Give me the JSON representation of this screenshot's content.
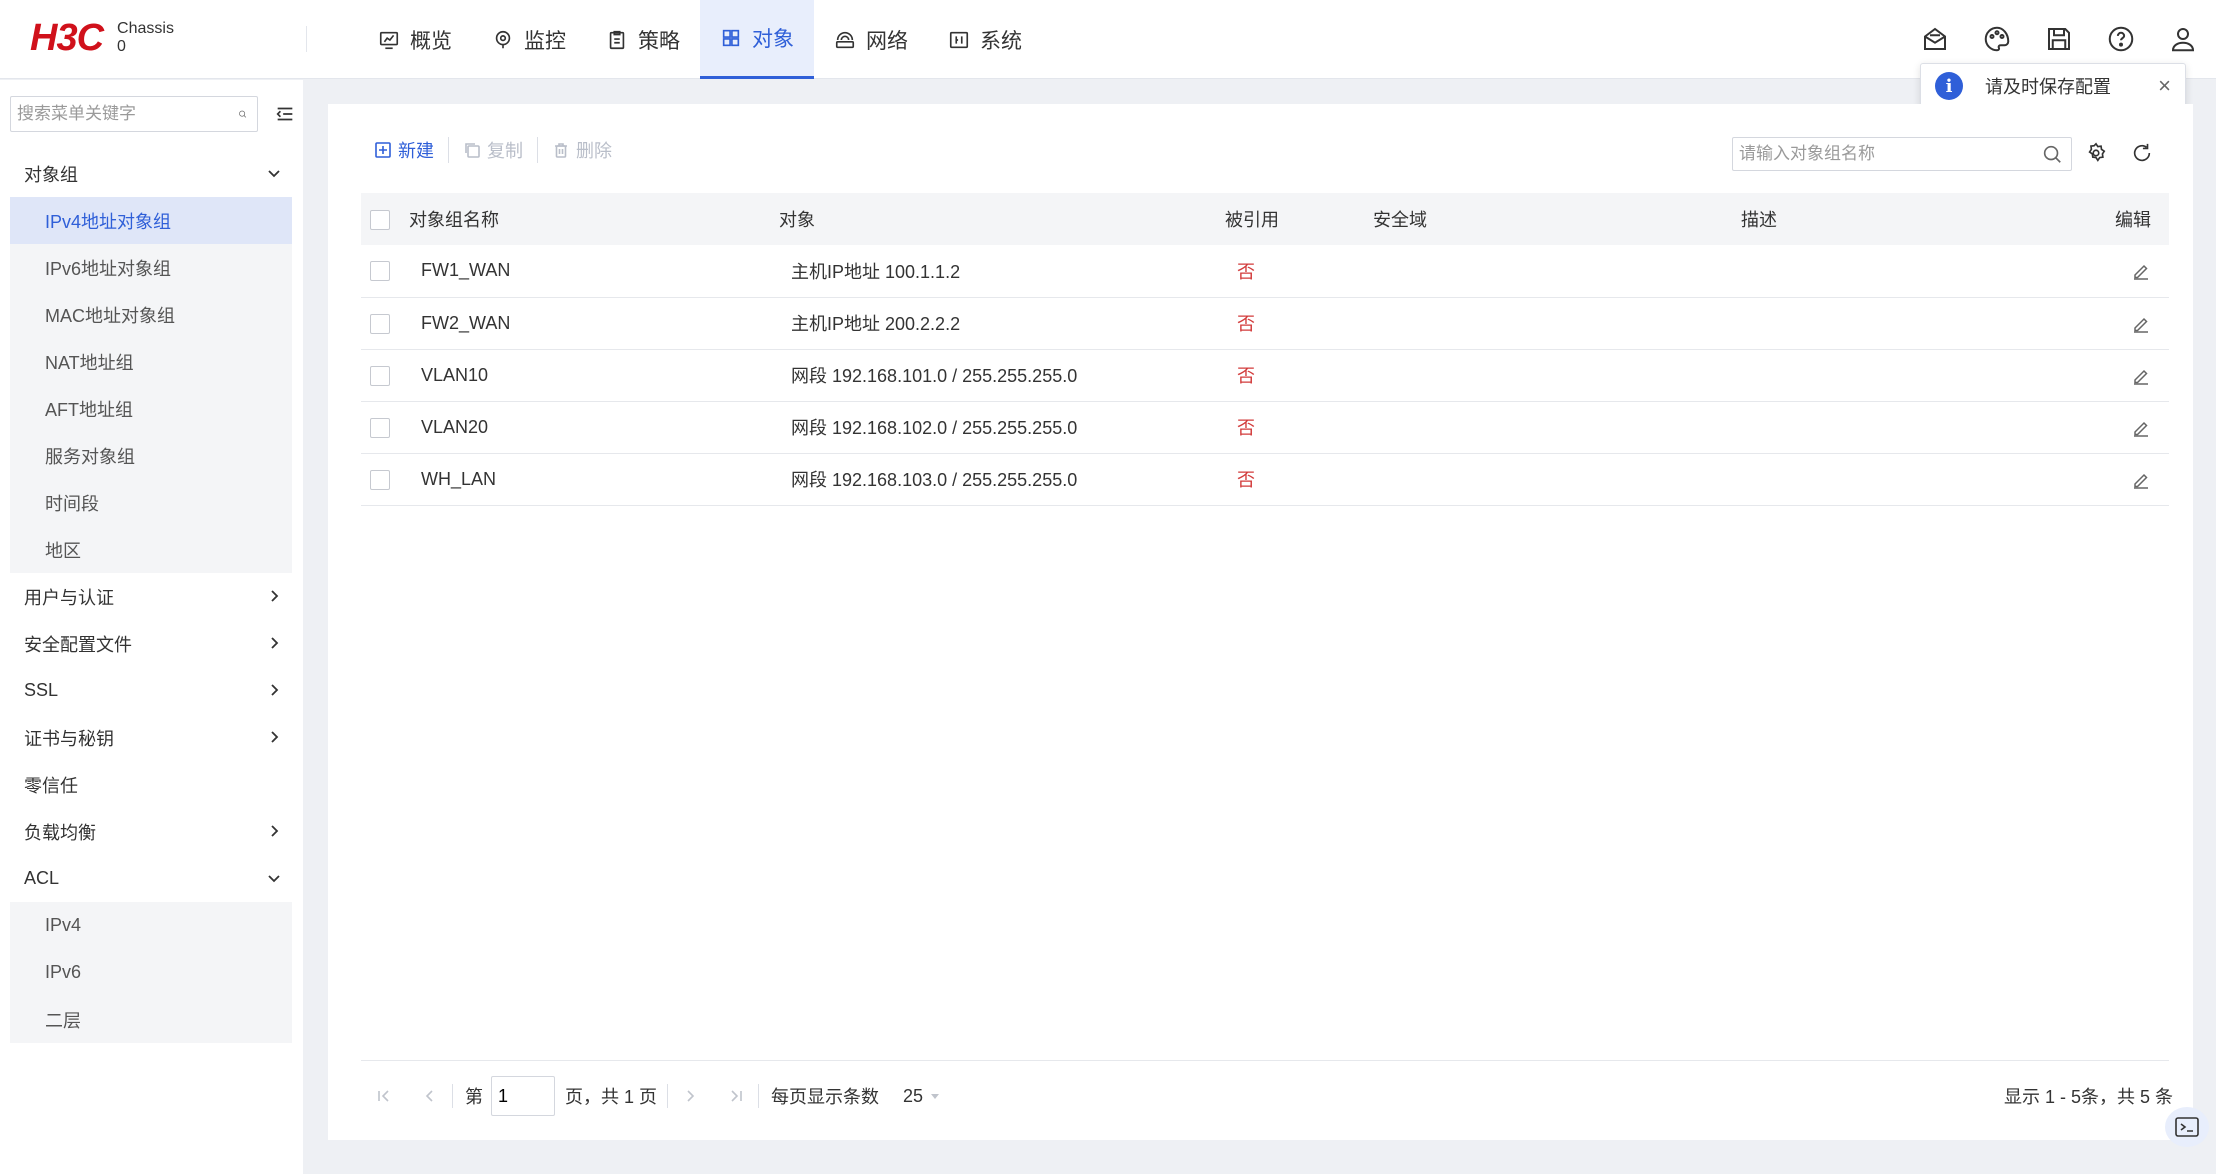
{
  "header": {
    "logo": "H3C",
    "device_line1": "Chassis",
    "device_line2": "0",
    "nav": [
      {
        "label": "概览",
        "icon": "overview-icon"
      },
      {
        "label": "监控",
        "icon": "monitor-icon"
      },
      {
        "label": "策略",
        "icon": "policy-icon"
      },
      {
        "label": "对象",
        "icon": "object-icon",
        "active": true
      },
      {
        "label": "网络",
        "icon": "network-icon"
      },
      {
        "label": "系统",
        "icon": "system-icon"
      }
    ],
    "tools": [
      "message-icon",
      "theme-icon",
      "save-icon",
      "help-icon",
      "user-icon"
    ]
  },
  "toast": {
    "message": "请及时保存配置",
    "close": "×"
  },
  "sidebar": {
    "search_placeholder": "搜索菜单关键字",
    "groups": [
      {
        "label": "对象组",
        "expanded": true,
        "items": [
          "IPv4地址对象组",
          "IPv6地址对象组",
          "MAC地址对象组",
          "NAT地址组",
          "AFT地址组",
          "服务对象组",
          "时间段",
          "地区"
        ]
      },
      {
        "label": "用户与认证",
        "expanded": false
      },
      {
        "label": "安全配置文件",
        "expanded": false
      },
      {
        "label": "SSL",
        "expanded": false
      },
      {
        "label": "证书与秘钥",
        "expanded": false
      },
      {
        "label": "零信任",
        "expanded": false,
        "leaf": true
      },
      {
        "label": "负载均衡",
        "expanded": false
      },
      {
        "label": "ACL",
        "expanded": true,
        "items": [
          "IPv4",
          "IPv6",
          "二层"
        ]
      }
    ],
    "active_item": "IPv4地址对象组"
  },
  "toolbar": {
    "new_label": "新建",
    "copy_label": "复制",
    "delete_label": "删除",
    "search_placeholder": "请输入对象组名称"
  },
  "table": {
    "headers": {
      "name": "对象组名称",
      "object": "对象",
      "referenced": "被引用",
      "zone": "安全域",
      "description": "描述",
      "edit": "编辑"
    },
    "rows": [
      {
        "name": "FW1_WAN",
        "object": "主机IP地址 100.1.1.2",
        "referenced": "否",
        "zone": "",
        "description": ""
      },
      {
        "name": "FW2_WAN",
        "object": "主机IP地址 200.2.2.2",
        "referenced": "否",
        "zone": "",
        "description": ""
      },
      {
        "name": "VLAN10",
        "object": "网段 192.168.101.0 / 255.255.255.0",
        "referenced": "否",
        "zone": "",
        "description": ""
      },
      {
        "name": "VLAN20",
        "object": "网段 192.168.102.0 / 255.255.255.0",
        "referenced": "否",
        "zone": "",
        "description": ""
      },
      {
        "name": "WH_LAN",
        "object": "网段 192.168.103.0 / 255.255.255.0",
        "referenced": "否",
        "zone": "",
        "description": ""
      }
    ]
  },
  "pager": {
    "page_prefix": "第",
    "page_value": "1",
    "page_suffix": "页，共 1 页",
    "page_size_label": "每页显示条数",
    "page_size": "25",
    "summary": "显示 1 - 5条，共 5 条"
  },
  "colors": {
    "accent": "#2f5fd8",
    "brand": "#d0111b",
    "negative": "#d23b3b"
  }
}
